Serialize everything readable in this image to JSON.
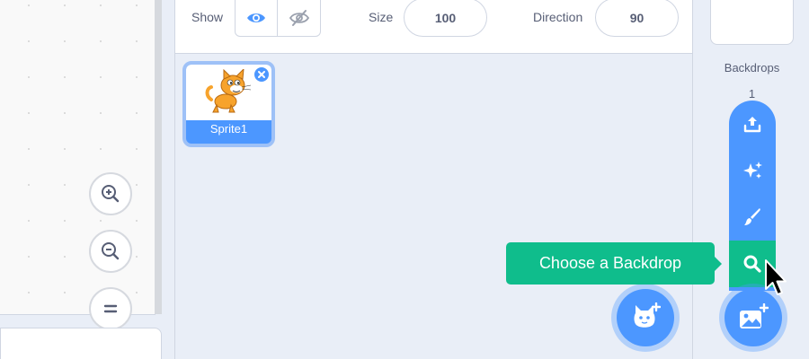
{
  "sprite_info": {
    "show_label": "Show",
    "size_label": "Size",
    "size_value": "100",
    "direction_label": "Direction",
    "direction_value": "90",
    "show_visible_icon": "eye-icon",
    "show_hidden_icon": "eye-slash-icon"
  },
  "sprites": [
    {
      "name": "Sprite1",
      "thumbnail": "cat-costume",
      "selected": true
    }
  ],
  "code_area": {
    "zoom_in_icon": "zoom-in-icon",
    "zoom_out_icon": "zoom-out-icon",
    "zoom_reset_icon": "equals-icon"
  },
  "stage_panel": {
    "backdrops_label": "Backdrops",
    "backdrops_count": "1"
  },
  "backdrop_menu": {
    "items": [
      {
        "icon": "upload-icon",
        "label": "Upload Backdrop"
      },
      {
        "icon": "surprise-icon",
        "label": "Surprise"
      },
      {
        "icon": "paint-icon",
        "label": "Paint"
      },
      {
        "icon": "search-icon",
        "label": "Choose a Backdrop",
        "active": true
      }
    ],
    "tooltip": "Choose a Backdrop"
  },
  "colors": {
    "primary": "#4c97ff",
    "active": "#0fbd8c",
    "text": "#575e75"
  }
}
